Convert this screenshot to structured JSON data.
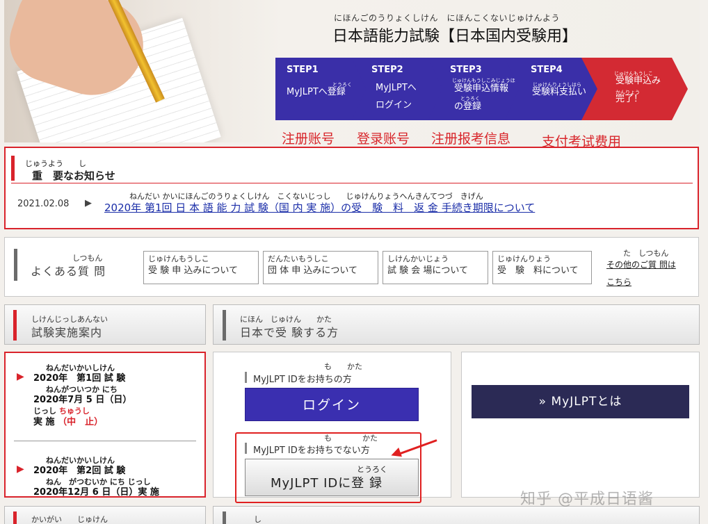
{
  "hero": {
    "ruby": "にほんごのうりょくしけん　にほんこくないじゅけんよう",
    "title": "日本語能力試験【日本国内受験用】"
  },
  "steps": [
    {
      "num": "STEP1",
      "ruby": "とうろく",
      "line1": "MyJLPTへ登録",
      "line2": ""
    },
    {
      "num": "STEP2",
      "ruby": "",
      "line1": "MyJLPTへ",
      "line2": "ログイン"
    },
    {
      "num": "STEP3",
      "ruby": "じゅけんもうしこみじょうほう",
      "line1": "受験申込情報",
      "ruby2": "とうろく",
      "line2": "の登録"
    },
    {
      "num": "STEP4",
      "ruby": "じゅけんりょうしはら",
      "line1": "受験料支払い",
      "line2": ""
    },
    {
      "num": "",
      "ruby": "じゅけんもうしこ",
      "line1": "受験申込み",
      "ruby2": "かんりょう",
      "line2": "完了！"
    }
  ],
  "cn_labels": [
    "注册账号",
    "登录账号",
    "注册报考信息",
    "支付考试费用"
  ],
  "notice": {
    "ruby": "じゅうよう　　し",
    "title": "重　要なお知らせ",
    "date": "2021.02.08",
    "arrow": "▶",
    "link_ruby": "ねんだい かいにほんごのうりょくしけん　こくないじっし　　じゅけんりょうへんきんてつづ　きげん",
    "link": "2020年 第1回 日 本 語 能 力 試 験（国 内 実 施）の受　験　料　返 金 手続き期限について"
  },
  "faq": {
    "ruby": "しつもん",
    "title": "よくある質 問",
    "buttons": [
      {
        "ruby": "じゅけんもうしこ",
        "label": "受 験 申 込みについて"
      },
      {
        "ruby": "だんたいもうしこ",
        "label": "団 体 申 込みについて"
      },
      {
        "ruby": "しけんかいじょう",
        "label": "試 験 会 場について"
      },
      {
        "ruby": "じゅけんりょう",
        "label": "受　験　料について"
      }
    ],
    "other_ruby": "た　しつもん",
    "other_line1": "その他のご質 問は",
    "other_line2": "こちら"
  },
  "exam_guide": {
    "ruby": "しけんじっしあんない",
    "title": "試験実施案内",
    "items": [
      {
        "r1": "ねんだいかいしけん",
        "l1": "2020年　第1回 試 験",
        "r2": "ねんがついつか にち",
        "l2": "2020年7月 5 日（日）",
        "l3a": "じっし ",
        "l3b": "ちゅうし",
        "l4a": "実 施 ",
        "l4b": "（中　止）"
      },
      {
        "r1": "ねんだいかいしけん",
        "l1": "2020年　第2回 試 験",
        "r2": "ねん　がつむいか にち じっし",
        "l2": "2020年12月 6 日（日）実 施"
      }
    ]
  },
  "domestic": {
    "ruby": "にほん　じゅけん　　かた",
    "title": "日本で受 験する方"
  },
  "myjlpt": {
    "have_ruby": "も　　かた",
    "have_label": "MyJLPT IDをお持ちの方",
    "login": "ログイン",
    "nothave_ruby": "も　　　　かた",
    "nothave_label": "MyJLPT IDをお持ちでない方",
    "register_ruby": "とうろく",
    "register": "MyJLPT IDに登 録",
    "about": "» MyJLPTとは"
  },
  "bottom": {
    "left_ruby": "かいがい　　じゅけん",
    "right_ruby": "し"
  },
  "watermark": "知乎 @平成日语酱",
  "colors": {
    "accent_red": "#d9232b",
    "step_blue": "#3a2fa8",
    "login_blue": "#3a2fb0",
    "dark_navy": "#2b2a55"
  }
}
